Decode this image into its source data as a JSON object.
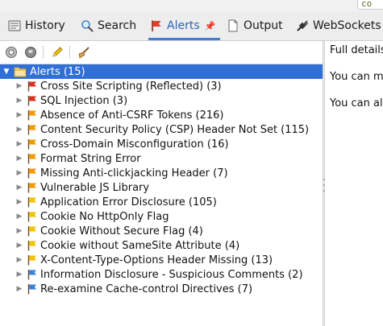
{
  "top": {
    "field_value": "co"
  },
  "tabs": [
    {
      "label": "History",
      "icon": "history-icon"
    },
    {
      "label": "Search",
      "icon": "search-icon"
    },
    {
      "label": "Alerts",
      "icon": "alert-flag-icon",
      "pinned": true
    },
    {
      "label": "Output",
      "icon": "document-icon"
    },
    {
      "label": "WebSockets",
      "icon": "websocket-plug-icon"
    }
  ],
  "active_tab": "Alerts",
  "toolbar": {
    "buttons": [
      "settings-target-icon",
      "globe-filter-icon",
      "pencil-edit-icon",
      "broom-clear-icon"
    ]
  },
  "tree": {
    "root_label": "Alerts (15)",
    "items": [
      {
        "label": "Cross Site Scripting (Reflected) (3)",
        "risk": "high"
      },
      {
        "label": "SQL Injection (3)",
        "risk": "high"
      },
      {
        "label": "Absence of Anti-CSRF Tokens (216)",
        "risk": "medium"
      },
      {
        "label": "Content Security Policy (CSP) Header Not Set (115)",
        "risk": "medium"
      },
      {
        "label": "Cross-Domain Misconfiguration (16)",
        "risk": "medium"
      },
      {
        "label": "Format String Error",
        "risk": "medium"
      },
      {
        "label": "Missing Anti-clickjacking Header (7)",
        "risk": "medium"
      },
      {
        "label": "Vulnerable JS Library",
        "risk": "medium"
      },
      {
        "label": "Application Error Disclosure (105)",
        "risk": "low"
      },
      {
        "label": "Cookie No HttpOnly Flag",
        "risk": "low"
      },
      {
        "label": "Cookie Without Secure Flag (4)",
        "risk": "low"
      },
      {
        "label": "Cookie without SameSite Attribute (4)",
        "risk": "low"
      },
      {
        "label": "X-Content-Type-Options Header Missing (13)",
        "risk": "low"
      },
      {
        "label": "Information Disclosure - Suspicious Comments (2)",
        "risk": "info"
      },
      {
        "label": "Re-examine Cache-control Directives (7)",
        "risk": "info"
      }
    ]
  },
  "right_panel": {
    "lines": [
      "Full details",
      "You can ma",
      "You can als"
    ]
  },
  "colors": {
    "high": "#d93025",
    "medium": "#f29900",
    "low": "#f2c200",
    "info": "#3c7fd8",
    "selection": "#2f6fd6",
    "active_tab": "#2a66b8"
  }
}
